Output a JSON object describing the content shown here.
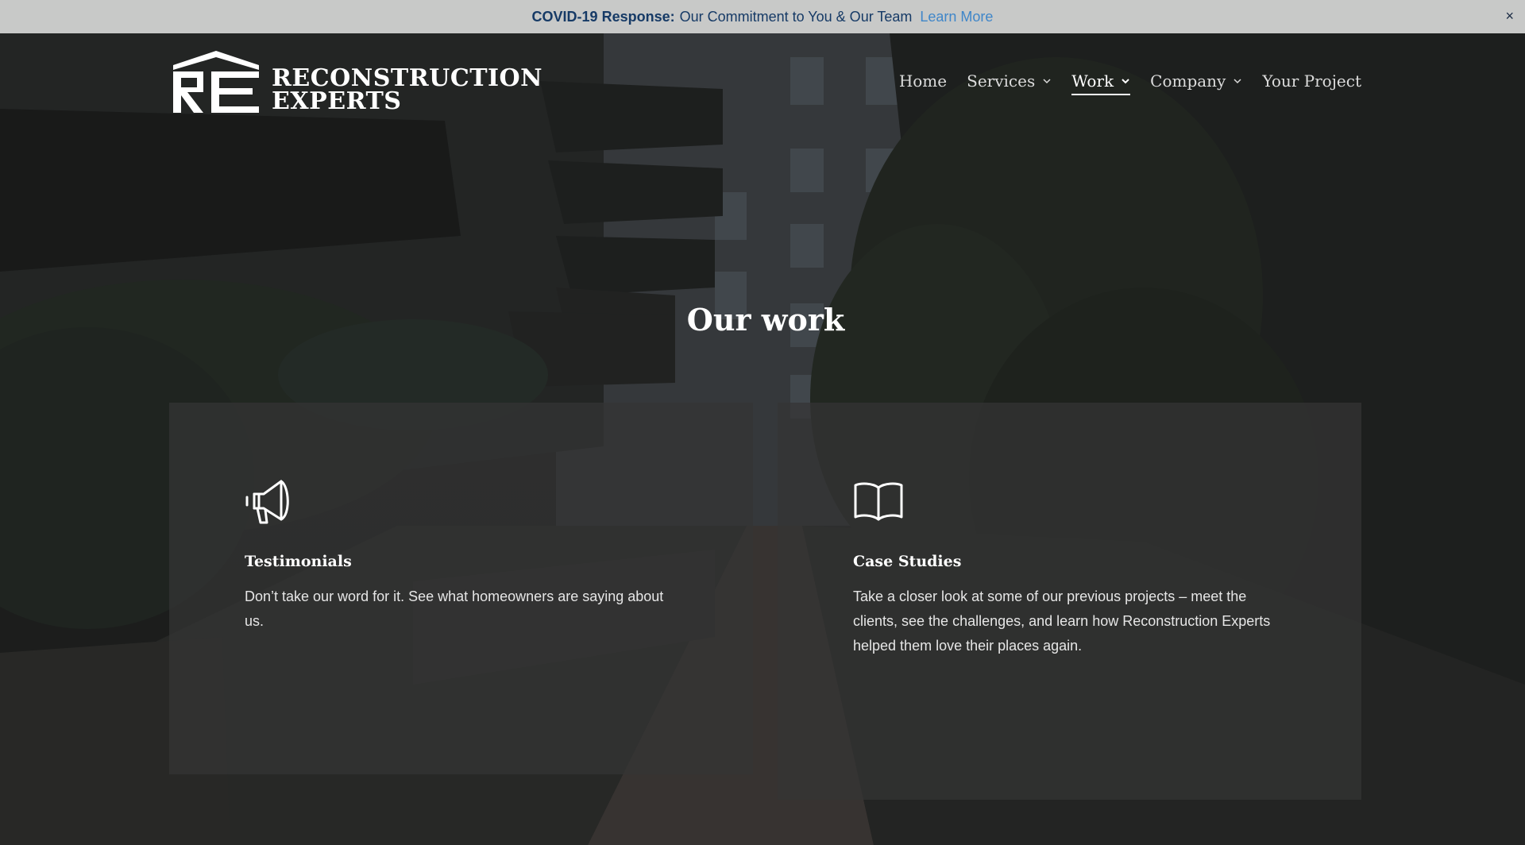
{
  "announcement": {
    "label": "COVID-19 Response:",
    "message": "Our Commitment to You & Our Team",
    "link": "Learn More",
    "close": "×"
  },
  "header": {
    "logo_line1": "RECONSTRUCTION",
    "logo_line2": "EXPERTS",
    "nav": [
      {
        "label": "Home",
        "dropdown": false,
        "active": false
      },
      {
        "label": "Services",
        "dropdown": true,
        "active": false
      },
      {
        "label": "Work",
        "dropdown": true,
        "active": true
      },
      {
        "label": "Company",
        "dropdown": true,
        "active": false
      },
      {
        "label": "Your Project",
        "dropdown": false,
        "active": false
      }
    ]
  },
  "main": {
    "title": "Our work",
    "cards": [
      {
        "icon": "megaphone-icon",
        "title": "Testimonials",
        "text": "Don’t take our word for it. See what homeowners are saying about us."
      },
      {
        "icon": "open-book-icon",
        "title": "Case Studies",
        "text": "Take a closer look at some of our previous projects – meet the clients, see the challenges, and learn how Reconstruction Experts helped them love their places again."
      }
    ]
  },
  "colors": {
    "announcement_bg": "#c8c9c8",
    "announcement_text": "#163a66",
    "link": "#3f86c9",
    "card_bg": "#343434"
  }
}
